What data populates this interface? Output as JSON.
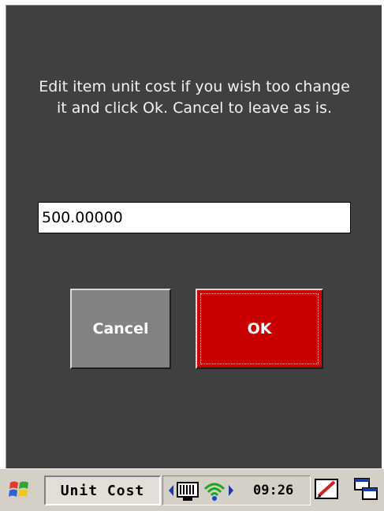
{
  "dialog": {
    "message": "Edit item unit cost if you wish too change\nit and click Ok. Cancel to leave as is.",
    "cost_value": "500.00000",
    "cancel_label": "Cancel",
    "ok_label": "OK"
  },
  "taskbar": {
    "active_task": "Unit Cost",
    "clock": "09:26",
    "icons": [
      "start-flag-icon",
      "left-arrow-icon",
      "keyboard-icon",
      "wifi-icon",
      "right-arrow-icon",
      "pen-input-icon",
      "windows-switcher-icon"
    ]
  },
  "colors": {
    "dialog_bg": "#404040",
    "ok_button": "#c80000",
    "cancel_button": "#828282",
    "taskbar_bg": "#d4d0c8"
  }
}
